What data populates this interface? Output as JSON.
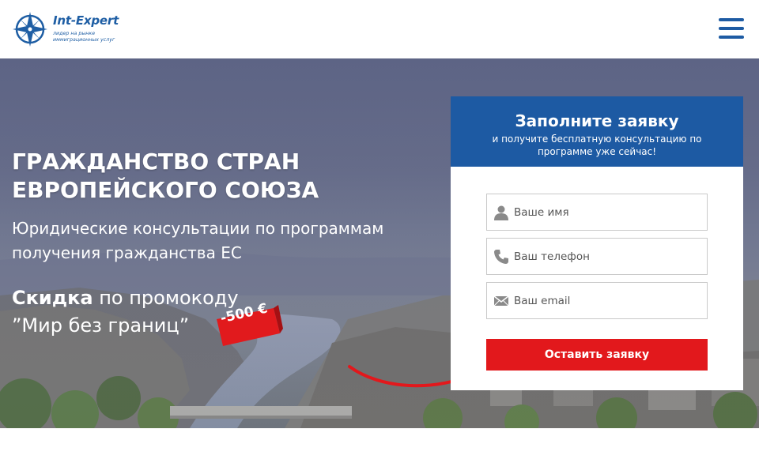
{
  "header": {
    "logo": {
      "name": "Int-Expert",
      "tagline": "лидер на рынке иммиграционных услуг",
      "icon": "compass-rose-icon",
      "color": "#1e5ea4"
    },
    "menu_icon": "hamburger-menu-icon"
  },
  "hero": {
    "headline_line1": "Гражданство стран",
    "headline_line2": "Европейского Союза",
    "subheadline_line1": "Юридические консультации по программам",
    "subheadline_line2": "получения гражданства ЕС",
    "promo_bold": "Скидка",
    "promo_rest": " по промокоду",
    "promo_code": "”Мир без границ”",
    "discount": "-500 €"
  },
  "form": {
    "title": "Заполните заявку",
    "subtitle": "и получите бесплатную консультацию по программе уже сейчас!",
    "fields": [
      {
        "icon": "user-icon",
        "placeholder": "Ваше имя",
        "value": ""
      },
      {
        "icon": "phone-icon",
        "placeholder": "Ваш телефон",
        "value": ""
      },
      {
        "icon": "envelope-icon",
        "placeholder": "Ваш email",
        "value": ""
      }
    ],
    "submit_label": "Оставить заявку"
  },
  "colors": {
    "brand_blue": "#1d5aa3",
    "accent_red": "#e2181c",
    "white": "#ffffff"
  }
}
